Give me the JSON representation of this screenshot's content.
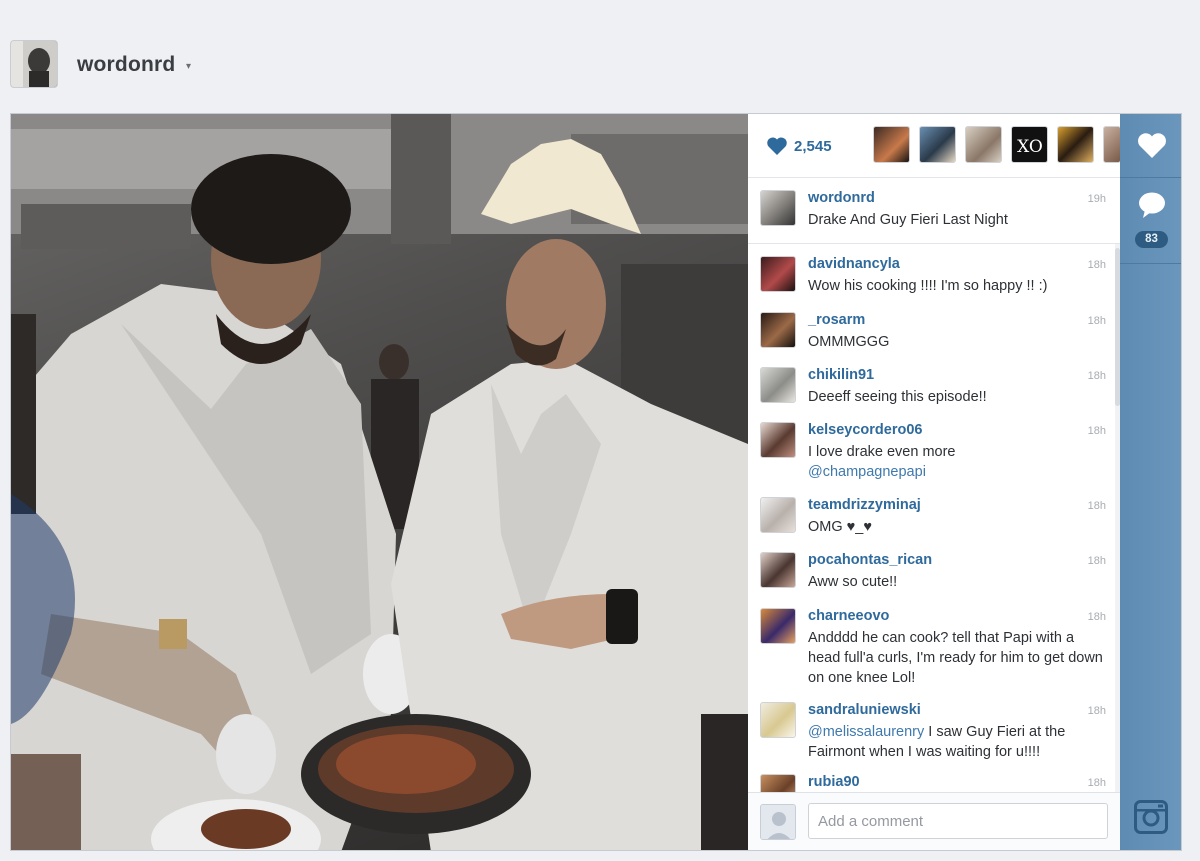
{
  "owner": {
    "username": "wordonrd",
    "caret": "▾"
  },
  "likes": {
    "count": "2,545",
    "icon": "heart-icon"
  },
  "caption": {
    "username": "wordonrd",
    "time": "19h",
    "text": "Drake And Guy Fieri Last Night"
  },
  "comments": [
    {
      "username": "davidnancyla",
      "time": "18h",
      "text": "Wow his cooking !!!! I'm so happy !! :)"
    },
    {
      "username": "_rosarm",
      "time": "18h",
      "text": "OMMMGGG"
    },
    {
      "username": "chikilin91",
      "time": "18h",
      "text": "Deeeff seeing this episode!!"
    },
    {
      "username": "kelseycordero06",
      "time": "18h",
      "text": "I love drake even more",
      "mention": "@champagnepapi"
    },
    {
      "username": "teamdrizzyminaj",
      "time": "18h",
      "text": "OMG ♥_♥"
    },
    {
      "username": "pocahontas_rican",
      "time": "18h",
      "text": "Aww so cute!!"
    },
    {
      "username": "charneeovo",
      "time": "18h",
      "text": "Andddd he can cook? tell that Papi with a head full'a curls, I'm ready for him to get down on one knee Lol!"
    },
    {
      "username": "sandraluniewski",
      "time": "18h",
      "mention": "@melissalaurenry",
      "text": " I saw Guy Fieri at the Fairmont when I was waiting for u!!!!"
    },
    {
      "username": "rubia90",
      "time": "18h",
      "text": ""
    }
  ],
  "comment_box": {
    "placeholder": "Add a comment"
  },
  "rail": {
    "comment_count": "83"
  },
  "icons": {
    "like": "heart-icon",
    "comment": "speech-bubble-icon",
    "brand": "instagram-camera-icon",
    "dropdown": "chevron-down-icon"
  },
  "colors": {
    "username": "#2f6a9c",
    "rail": "#6591b7",
    "badge": "#2e5b82",
    "background": "#eef0f3"
  }
}
